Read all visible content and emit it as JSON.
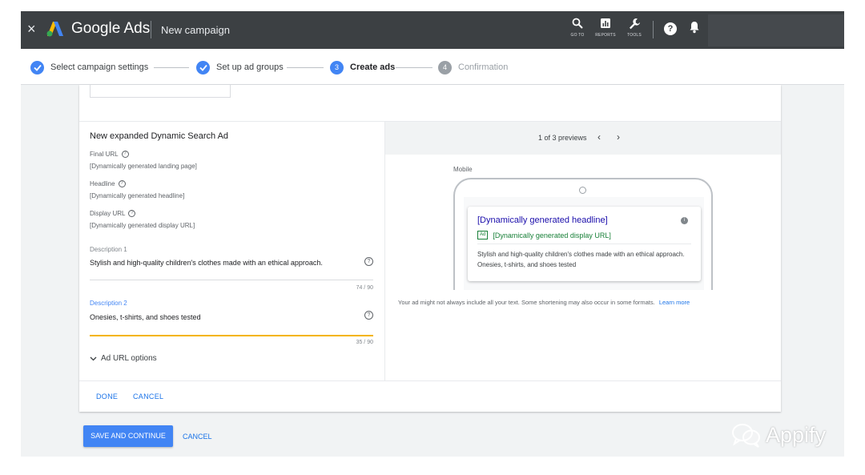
{
  "topbar": {
    "close_glyph": "×",
    "logo_icon": "google-ads-logo",
    "product": "Google Ads",
    "page": "New campaign",
    "tools": [
      {
        "icon": "search-icon",
        "label": "GO TO"
      },
      {
        "icon": "reports-icon",
        "label": "REPORTS"
      },
      {
        "icon": "wrench-icon",
        "label": "TOOLS"
      }
    ],
    "help_glyph": "?"
  },
  "stepper": {
    "steps": [
      {
        "label": "Select campaign settings",
        "state": "complete"
      },
      {
        "label": "Set up ad groups",
        "state": "complete"
      },
      {
        "number": "3",
        "label": "Create ads",
        "state": "active"
      },
      {
        "number": "4",
        "label": "Confirmation",
        "state": "pending"
      }
    ]
  },
  "form": {
    "title": "New expanded Dynamic Search Ad",
    "final_url": {
      "label": "Final URL",
      "value": "[Dynamically generated landing page]"
    },
    "headline": {
      "label": "Headline",
      "value": "[Dynamically generated headline]"
    },
    "display_url": {
      "label": "Display URL",
      "value": "[Dynamically generated display URL]"
    },
    "description1": {
      "label": "Description 1",
      "value": "Stylish and high-quality children's clothes made with an ethical approach.",
      "counter": "74 / 90"
    },
    "description2": {
      "label": "Description 2",
      "value": "Onesies, t-shirts, and shoes tested",
      "counter": "35 / 90"
    },
    "url_options": "Ad URL options",
    "help_glyph": "?"
  },
  "preview": {
    "count": "1 of 3 previews",
    "prev_glyph": "‹",
    "next_glyph": "›",
    "device_label": "Mobile",
    "ad": {
      "headline": "[Dynamically generated headline]",
      "badge": "Ad",
      "display_url": "[Dynamically generated display URL]",
      "description": "Stylish and high-quality children's clothes made with an ethical approach. Onesies, t-shirts, and shoes tested",
      "info_glyph": "i"
    },
    "disclaimer": "Your ad might not always include all your text. Some shortening may also occur in some formats.",
    "learn_more": "Learn more"
  },
  "card_actions": {
    "done": "DONE",
    "cancel": "CANCEL"
  },
  "page_actions": {
    "save": "SAVE AND CONTINUE",
    "cancel": "CANCEL"
  },
  "watermark": {
    "text": "Appify",
    "icon": "wechat-icon"
  },
  "colors": {
    "topbar": "#3c4043",
    "primary": "#4285f4",
    "link": "#1a73e8",
    "ad_headline": "#1a0dab",
    "ad_url": "#188038",
    "focus_underline": "#f4b400"
  }
}
